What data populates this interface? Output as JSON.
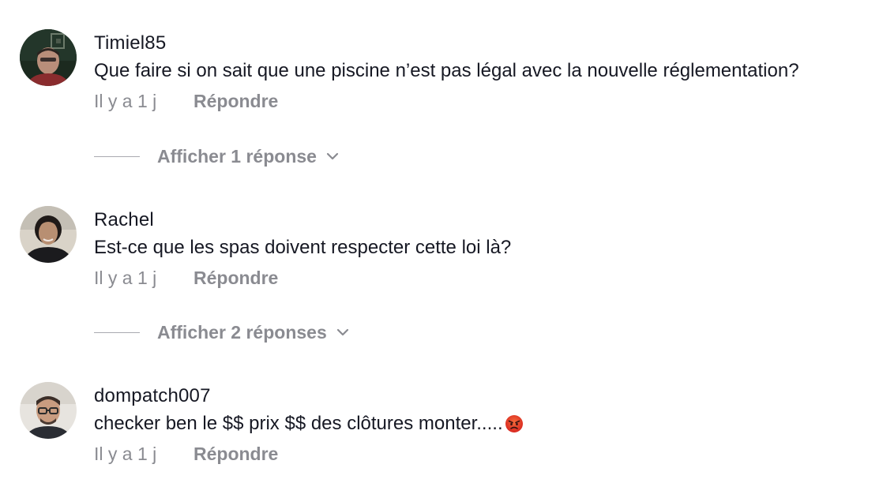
{
  "comments": [
    {
      "username": "Timiel85",
      "text": "Que faire si on sait que une piscine n’est pas légal avec la nouvelle réglementation?",
      "time": "Il y a 1 j",
      "reply_label": "Répondre",
      "replies_label": "Afficher 1 réponse"
    },
    {
      "username": "Rachel",
      "text": "Est-ce que les spas doivent respecter cette loi là?",
      "time": "Il y a 1 j",
      "reply_label": "Répondre",
      "replies_label": "Afficher 2 réponses"
    },
    {
      "username": "dompatch007",
      "text": "checker ben le $$ prix $$ des clôtures monter.....",
      "emoji": "angry-face-emoji",
      "time": "Il y a 1 j",
      "reply_label": "Répondre"
    }
  ]
}
